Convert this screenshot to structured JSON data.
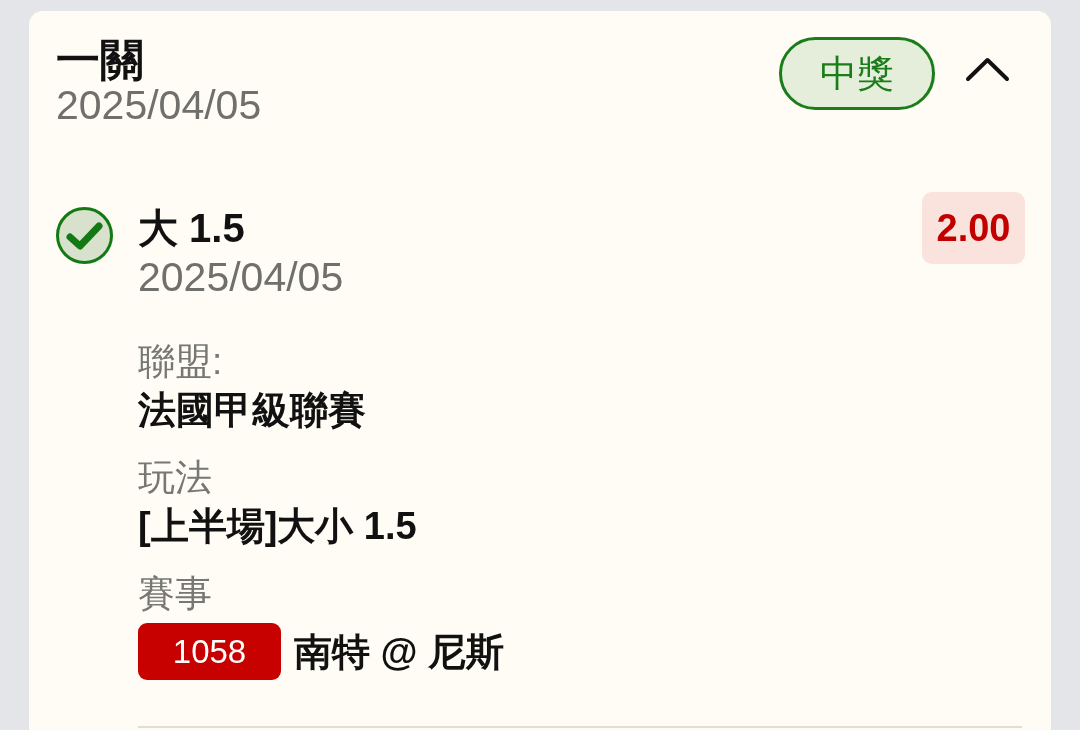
{
  "card": {
    "title": "一關",
    "date": "2025/04/05",
    "status_badge": "中獎",
    "expanded": true
  },
  "legs": [
    {
      "won": true,
      "selection": "大 1.5",
      "date": "2025/04/05",
      "odds": "2.00",
      "fields": [
        {
          "kind": "text",
          "label": "聯盟:",
          "value": "法國甲級聯賽"
        },
        {
          "kind": "text",
          "label": "玩法",
          "value": "[上半場]大小 1.5"
        },
        {
          "kind": "event",
          "label": "賽事",
          "event_no": "1058",
          "value": "南特 @ 尼斯"
        }
      ]
    }
  ]
}
